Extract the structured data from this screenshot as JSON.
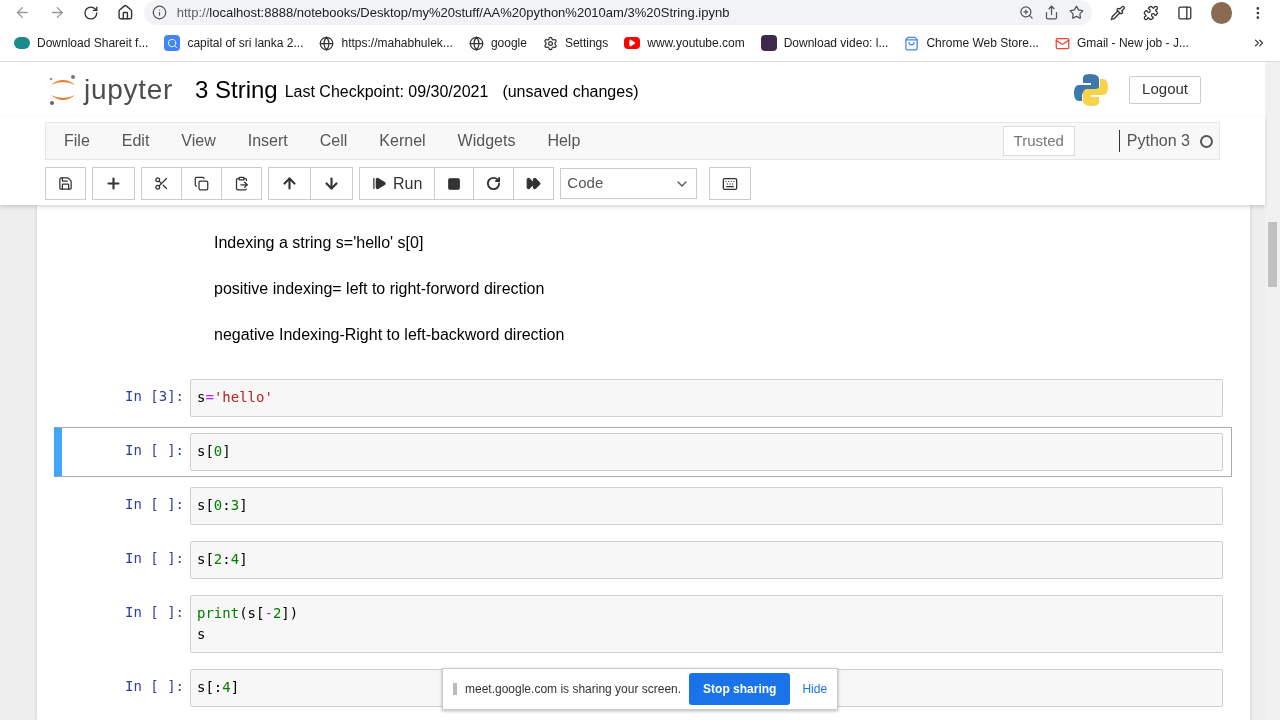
{
  "browser": {
    "url": "localhost:8888/notebooks/Desktop/my%20stuff/AA%20python%2010am/3%20String.ipynb",
    "url_scheme": "http://",
    "bookmarks": [
      {
        "label": "Download Shareit f...",
        "kind": "app"
      },
      {
        "label": "capital of sri lanka 2...",
        "kind": "search"
      },
      {
        "label": "https://mahabhulek...",
        "kind": "globe"
      },
      {
        "label": "google",
        "kind": "globe"
      },
      {
        "label": "Settings",
        "kind": "settings"
      },
      {
        "label": "www.youtube.com",
        "kind": "video"
      },
      {
        "label": "Download video: l...",
        "kind": "q"
      },
      {
        "label": "Chrome Web Store...",
        "kind": "store"
      },
      {
        "label": "Gmail - New job - J...",
        "kind": "mail"
      }
    ]
  },
  "header": {
    "logo_text": "jupyter",
    "notebook_title": "3 String",
    "checkpoint": "Last Checkpoint: 09/30/2021",
    "unsaved": "(unsaved changes)",
    "logout": "Logout"
  },
  "menu": [
    "File",
    "Edit",
    "View",
    "Insert",
    "Cell",
    "Kernel",
    "Widgets",
    "Help"
  ],
  "status": {
    "trusted": "Trusted",
    "kernel": "Python 3",
    "kernel_busy": false
  },
  "toolbar": {
    "run_label": "Run",
    "cell_type": "Code"
  },
  "cells": [
    {
      "kind": "markdown",
      "paragraphs": [
        "Indexing a string s='hello' s[0]",
        "positive indexing= left to right-forword direction",
        "negative Indexing-Right to left-backword direction"
      ]
    },
    {
      "kind": "code",
      "prompt": "In [3]:",
      "selected": false,
      "lines": [
        [
          {
            "t": "s",
            "kind": "name"
          },
          {
            "t": "=",
            "kind": "op"
          },
          {
            "t": "'hello'",
            "kind": "string"
          }
        ]
      ]
    },
    {
      "kind": "code",
      "prompt": "In [ ]:",
      "selected": true,
      "lines": [
        [
          {
            "t": "s[",
            "kind": "name"
          },
          {
            "t": "0",
            "kind": "number"
          },
          {
            "t": "]",
            "kind": "name"
          }
        ]
      ]
    },
    {
      "kind": "code",
      "prompt": "In [ ]:",
      "selected": false,
      "lines": [
        [
          {
            "t": "s[",
            "kind": "name"
          },
          {
            "t": "0",
            "kind": "number"
          },
          {
            "t": ":",
            "kind": "name"
          },
          {
            "t": "3",
            "kind": "number"
          },
          {
            "t": "]",
            "kind": "name"
          }
        ]
      ]
    },
    {
      "kind": "code",
      "prompt": "In [ ]:",
      "selected": false,
      "lines": [
        [
          {
            "t": "s[",
            "kind": "name"
          },
          {
            "t": "2",
            "kind": "number"
          },
          {
            "t": ":",
            "kind": "name"
          },
          {
            "t": "4",
            "kind": "number"
          },
          {
            "t": "]",
            "kind": "name"
          }
        ]
      ]
    },
    {
      "kind": "code",
      "prompt": "In [ ]:",
      "selected": false,
      "lines": [
        [
          {
            "t": "print",
            "kind": "builtin"
          },
          {
            "t": "(s[",
            "kind": "name"
          },
          {
            "t": "-",
            "kind": "op"
          },
          {
            "t": "2",
            "kind": "number"
          },
          {
            "t": "])",
            "kind": "name"
          }
        ],
        [
          {
            "t": "s",
            "kind": "name"
          }
        ]
      ]
    },
    {
      "kind": "code",
      "prompt": "In [ ]:",
      "selected": false,
      "lines": [
        [
          {
            "t": "s[:",
            "kind": "name"
          },
          {
            "t": "4",
            "kind": "number"
          },
          {
            "t": "]",
            "kind": "name"
          }
        ]
      ]
    }
  ],
  "share_bar": {
    "message": "meet.google.com is sharing your screen.",
    "stop": "Stop sharing",
    "hide": "Hide"
  }
}
